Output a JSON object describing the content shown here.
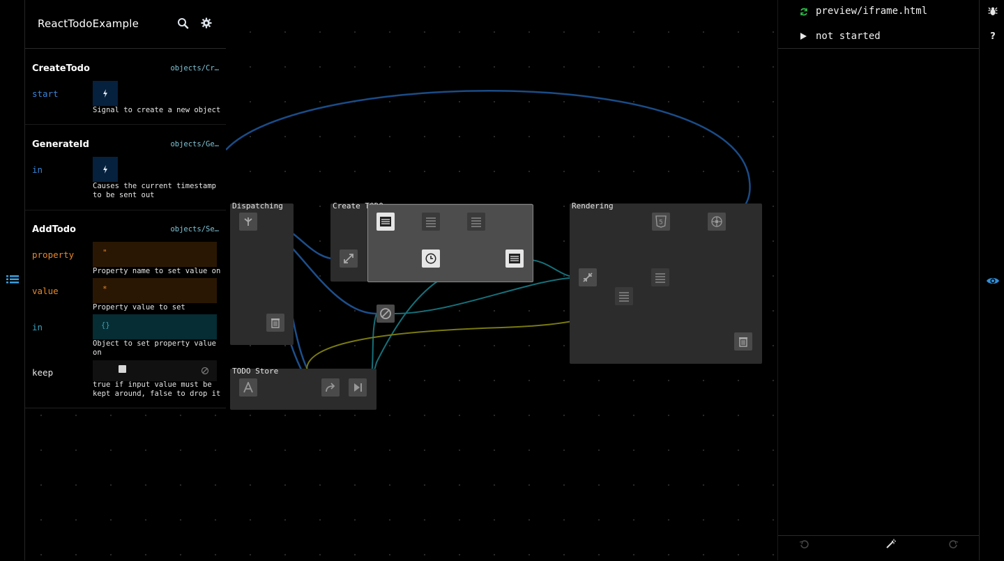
{
  "project": {
    "title": "ReactTodoExample"
  },
  "preview": {
    "file": "preview/iframe.html",
    "status": "not started"
  },
  "inspector": {
    "components": [
      {
        "name": "CreateTodo",
        "path": "objects/Cr…",
        "ports": [
          {
            "name": "start",
            "value": "",
            "description": "Signal to create a new object"
          }
        ]
      },
      {
        "name": "GenerateId",
        "path": "objects/Ge…",
        "ports": [
          {
            "name": "in",
            "value": "",
            "description": "Causes the current timestamp to be sent out"
          }
        ]
      },
      {
        "name": "AddTodo",
        "path": "objects/Se…",
        "ports": [
          {
            "name": "property",
            "value": "\"",
            "description": "Property name to set value on"
          },
          {
            "name": "value",
            "value": "*",
            "description": "Property value to set"
          },
          {
            "name": "in",
            "value": "{}",
            "description": "Object to set property value on"
          },
          {
            "name": "keep",
            "value": "",
            "description": "true if input value must be kept around, false to drop it"
          }
        ]
      }
    ]
  },
  "graph": {
    "groups": [
      {
        "label": "Dispatching"
      },
      {
        "label": "Create TODO"
      },
      {
        "label": "Rendering"
      },
      {
        "label": "TODO Store"
      }
    ]
  },
  "colors": {
    "edge_blue": "#1d4f8c",
    "edge_orange": "#b86a12",
    "edge_teal": "#16707a",
    "edge_yellow": "#8a8a14",
    "edge_red": "#9b1b1b",
    "edge_purple": "#8e1a6e",
    "refresh_icon": "#2fbf4a"
  },
  "icons": {
    "header": [
      "search-icon",
      "gear-icon"
    ],
    "left_rail": [
      "list-icon"
    ],
    "right_rail": [
      "bug-icon",
      "help-icon",
      "eye-icon"
    ],
    "footer": [
      "undo-icon",
      "magic-wand-icon",
      "redo-icon"
    ],
    "preview": [
      "refresh-icon",
      "play-icon"
    ]
  }
}
